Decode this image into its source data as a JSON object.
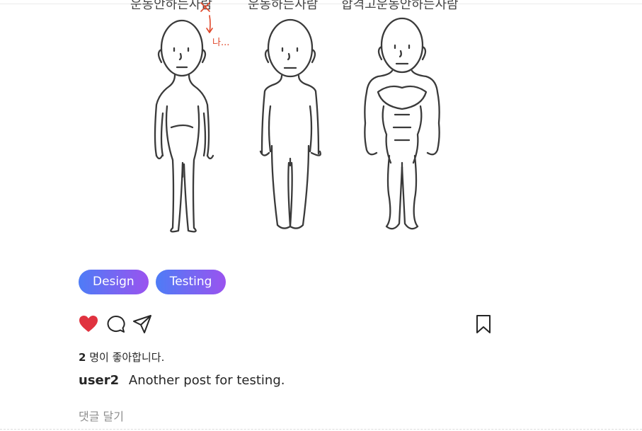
{
  "post": {
    "image": {
      "alt": "세 가지 체형 비교 그림",
      "captions": [
        "운동안하는사람",
        "운동하는사람",
        "합격고운동안하는사람"
      ],
      "annotation": "나..."
    },
    "tags": [
      "Design",
      "Testing"
    ],
    "likes": {
      "count": "2",
      "text": "명이 좋아합니다."
    },
    "caption": {
      "username": "user2",
      "text": "Another post for testing."
    },
    "comment": {
      "placeholder": "댓글 달기",
      "value": ""
    }
  },
  "icons": {
    "like": "heart-icon",
    "comment": "comment-bubble-icon",
    "share": "paper-plane-icon",
    "bookmark": "bookmark-icon"
  },
  "colors": {
    "like_active": "#e0323f",
    "tag_gradient_start": "#4e7cf6",
    "tag_gradient_end": "#9a53ef",
    "text": "#262626",
    "placeholder": "#8e8e8e",
    "annotation": "#e0472a"
  }
}
